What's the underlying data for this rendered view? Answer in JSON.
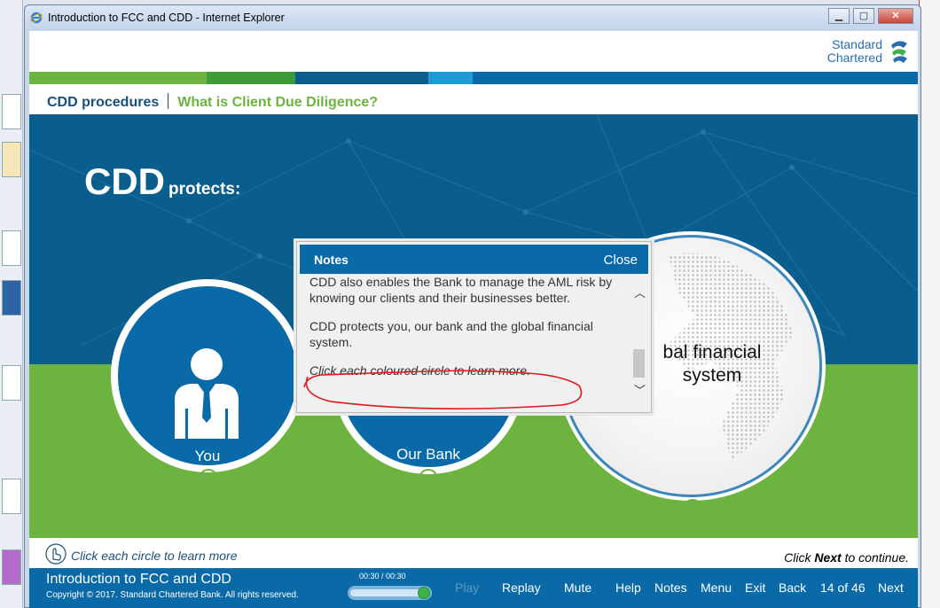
{
  "window": {
    "title": "Introduction to FCC and CDD - Internet Explorer"
  },
  "brand": {
    "line1": "Standard",
    "line2": "Chartered"
  },
  "breadcrumb": {
    "section": "CDD procedures",
    "page": "What is Client Due Diligence?"
  },
  "colors": {
    "green": "#6cb33f",
    "blue": "#0a6aa8",
    "dark_blue": "#0a5e8e",
    "light_blue": "#1e9ad6"
  },
  "stage": {
    "heading_big": "CDD",
    "heading_small": "protects:",
    "circles": [
      {
        "label": "You",
        "icon": "businessman-icon"
      },
      {
        "label": "Our Bank",
        "icon": "bank-icon"
      },
      {
        "label": "Global financial system",
        "icon": "globe-icon",
        "visible_text_line1": "bal financial",
        "visible_text_line2": "system"
      }
    ]
  },
  "notes": {
    "title": "Notes",
    "close_label": "Close",
    "paragraph1": "CDD also enables the Bank to manage the AML risk by knowing our clients and their businesses better.",
    "paragraph2": "CDD protects you, our bank and the global financial system.",
    "paragraph3": "Click each coloured circle to learn more."
  },
  "hint": {
    "left": "Click each circle to learn more",
    "right_prefix": "Click ",
    "right_bold": "Next",
    "right_suffix": " to continue."
  },
  "footer": {
    "course_title": "Introduction to FCC and CDD",
    "copyright": "Copyright © 2017. Standard Chartered Bank. All rights reserved.",
    "time": "00:30 / 00:30",
    "progress_fraction": 1.0,
    "play": "Play",
    "replay": "Replay",
    "mute": "Mute",
    "help": "Help",
    "notes": "Notes",
    "menu": "Menu",
    "exit": "Exit",
    "back": "Back",
    "page_counter": "14 of 46",
    "next": "Next"
  }
}
